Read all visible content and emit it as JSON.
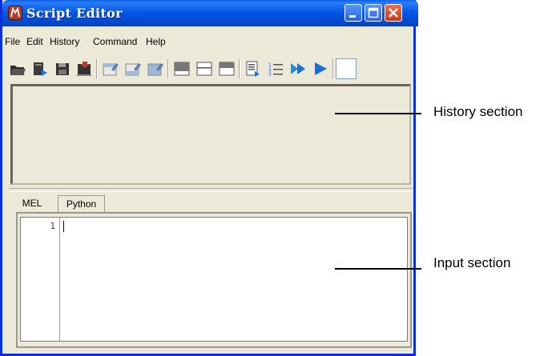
{
  "window": {
    "title": "Script Editor"
  },
  "menu": [
    "File",
    "Edit",
    "History",
    "Command",
    "Help"
  ],
  "tabs": {
    "mel": "MEL",
    "python": "Python",
    "active": "Python"
  },
  "editor": {
    "line_number": "1"
  },
  "annotations": {
    "history": "History section",
    "input": "Input section"
  },
  "colors": {
    "titlebar": "#0055e5",
    "panel": "#ece9d8",
    "close_button": "#c8391c"
  },
  "toolbar_icons": [
    "open-script-icon",
    "source-script-icon",
    "save-script-icon",
    "save-to-shelf-icon",
    "clear-history-icon",
    "clear-input-icon",
    "clear-all-icon",
    "show-history-only-icon",
    "show-input-only-icon",
    "show-both-icon",
    "echo-all-commands-icon",
    "show-line-numbers-icon",
    "execute-all-icon",
    "execute-icon"
  ]
}
